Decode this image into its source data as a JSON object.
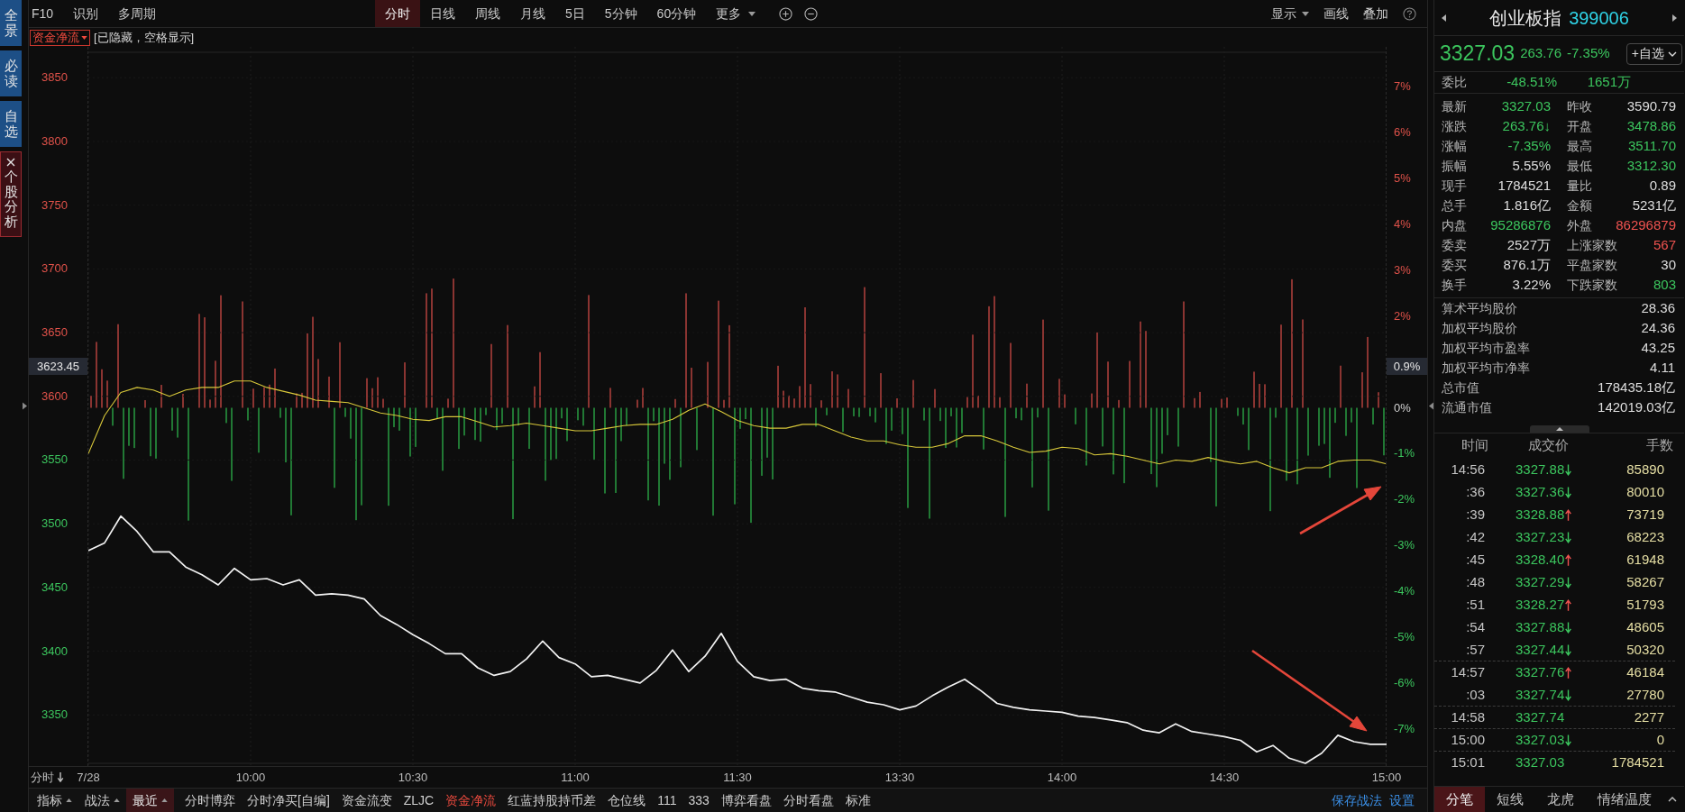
{
  "sidebar": {
    "tabs": [
      {
        "label": "全景",
        "selected": false
      },
      {
        "label": "必读",
        "selected": false
      },
      {
        "label": "自选",
        "selected": false
      },
      {
        "label": "个股分析",
        "selected": true
      }
    ]
  },
  "toolbar": {
    "left": [
      "F10",
      "识别",
      "多周期"
    ],
    "periods": [
      {
        "label": "分时",
        "selected": true
      },
      {
        "label": "日线",
        "selected": false
      },
      {
        "label": "周线",
        "selected": false
      },
      {
        "label": "月线",
        "selected": false
      },
      {
        "label": "5日",
        "selected": false
      },
      {
        "label": "5分钟",
        "selected": false
      },
      {
        "label": "60分钟",
        "selected": false
      }
    ],
    "more": "更多",
    "right": [
      {
        "label": "显示",
        "kind": "menu"
      },
      {
        "label": "画线",
        "kind": "button"
      },
      {
        "label": "叠加",
        "kind": "button"
      }
    ]
  },
  "indicator_bar": {
    "dropdown": "资金净流",
    "note": "[已隐藏，空格显示]"
  },
  "chart": {
    "price_tag": "3623.45",
    "percent_tag": "0.9%",
    "time_button": "分时",
    "chart_data": {
      "type": "line",
      "categories": [
        "7/28",
        null,
        null,
        null,
        null,
        null,
        null,
        null,
        null,
        null,
        "10:00",
        null,
        null,
        null,
        null,
        null,
        null,
        null,
        null,
        null,
        "10:30",
        null,
        null,
        null,
        null,
        null,
        null,
        null,
        null,
        null,
        "11:00",
        null,
        null,
        null,
        null,
        null,
        null,
        null,
        null,
        null,
        "11:30",
        null,
        null,
        null,
        null,
        null,
        null,
        null,
        null,
        null,
        "13:30",
        null,
        null,
        null,
        null,
        null,
        null,
        null,
        null,
        null,
        "14:00",
        null,
        null,
        null,
        null,
        null,
        null,
        null,
        null,
        null,
        "14:30",
        null,
        null,
        null,
        null,
        null,
        null,
        null,
        null,
        null,
        "15:00"
      ],
      "series": [
        {
          "color": "#f2f2f2",
          "values": [
            3479,
            3485,
            3506,
            3494,
            3478,
            3478,
            3466,
            3460,
            3452,
            3465,
            3456,
            3457,
            3452,
            3456,
            3444,
            3445,
            3444,
            3441,
            3428,
            3421,
            3413,
            3406,
            3398,
            3398,
            3387,
            3381,
            3384,
            3394,
            3408,
            3395,
            3390,
            3380,
            3381,
            3378,
            3375,
            3385,
            3401,
            3384,
            3396,
            3414,
            3392,
            3380,
            3377,
            3378,
            3371,
            3369,
            3368,
            3364,
            3360,
            3358,
            3354,
            3357,
            3365,
            3372,
            3378,
            3369,
            3359,
            3356,
            3354,
            3353,
            3352,
            3349,
            3348,
            3346,
            3344,
            3338,
            3336,
            3343,
            3337,
            3335,
            3333,
            3330,
            3321,
            3326,
            3316,
            3312,
            3320,
            3334,
            3329,
            3327,
            3327
          ]
        },
        {
          "color": "#d8c83a",
          "values": [
            3555,
            3585,
            3603,
            3607,
            3605,
            3600,
            3605,
            3607,
            3607,
            3612,
            3612,
            3607,
            3604,
            3601,
            3597,
            3596,
            3595,
            3591,
            3587,
            3585,
            3582,
            3581,
            3584,
            3584,
            3580,
            3576,
            3577,
            3579,
            3577,
            3575,
            3573,
            3573,
            3575,
            3577,
            3578,
            3578,
            3582,
            3589,
            3594,
            3588,
            3581,
            3577,
            3575,
            3575,
            3578,
            3578,
            3573,
            3568,
            3565,
            3565,
            3562,
            3560,
            3560,
            3563,
            3569,
            3569,
            3565,
            3560,
            3556,
            3557,
            3560,
            3559,
            3554,
            3555,
            3553,
            3550,
            3547,
            3550,
            3549,
            3552,
            3549,
            3547,
            3549,
            3544,
            3540,
            3544,
            3544,
            3549,
            3550,
            3550,
            3547
          ]
        }
      ],
      "ylim": [
        3312,
        3870
      ],
      "yticks": [
        3350,
        3400,
        3450,
        3500,
        3550,
        3600,
        3650,
        3700,
        3750,
        3800,
        3850
      ],
      "grid": true,
      "y2lim": [
        -7.75,
        7.75
      ],
      "y2ticks": [
        {
          "value": 7,
          "label": "7%"
        },
        {
          "value": 6,
          "label": "6%"
        },
        {
          "value": 5,
          "label": "5%"
        },
        {
          "value": 4,
          "label": "4%"
        },
        {
          "value": 3,
          "label": "3%"
        },
        {
          "value": 2,
          "label": "2%"
        },
        {
          "value": 0,
          "label": "0%"
        },
        {
          "value": -1,
          "label": "-1%"
        },
        {
          "value": -2,
          "label": "-2%"
        },
        {
          "value": -3,
          "label": "-3%"
        },
        {
          "value": -4,
          "label": "-4%"
        },
        {
          "value": -5,
          "label": "-5%"
        },
        {
          "value": -6,
          "label": "-6%"
        },
        {
          "value": -7,
          "label": "-7%"
        }
      ]
    }
  },
  "bottom_bar": {
    "menus": [
      {
        "label": "指标",
        "selected": false
      },
      {
        "label": "战法",
        "selected": false
      },
      {
        "label": "最近",
        "selected": true
      }
    ],
    "indicators": [
      {
        "label": "分时博弈",
        "selected": false
      },
      {
        "label": "分时净买[自编]",
        "selected": false
      },
      {
        "label": "资金流变",
        "selected": false
      },
      {
        "label": "ZLJC",
        "selected": false
      },
      {
        "label": "资金净流",
        "selected": true
      },
      {
        "label": "红蓝持股持币差",
        "selected": false
      },
      {
        "label": "仓位线",
        "selected": false
      },
      {
        "label": "111",
        "selected": false
      },
      {
        "label": "333",
        "selected": false
      },
      {
        "label": "博弈看盘",
        "selected": false
      },
      {
        "label": "分时看盘",
        "selected": false
      },
      {
        "label": "标准",
        "selected": false
      }
    ],
    "links": [
      "保存战法",
      "设置"
    ]
  },
  "quote_panel": {
    "name": "创业板指",
    "code": "399006",
    "down": true,
    "price": "3327.03",
    "change": "263.76",
    "change_pct": "-7.35%",
    "watch_button": "+自选",
    "commission": {
      "label": "委比",
      "ratio": "-48.51%",
      "diff": "1651万",
      "down": true
    },
    "stats": [
      {
        "label": "最新",
        "value": "3327.03",
        "color": "#3cc65e"
      },
      {
        "label": "昨收",
        "value": "3590.79",
        "color": "#dedede"
      },
      {
        "label": "涨跌",
        "value": "263.76↓",
        "color": "#3cc65e"
      },
      {
        "label": "开盘",
        "value": "3478.86",
        "color": "#3cc65e"
      },
      {
        "label": "涨幅",
        "value": "-7.35%",
        "color": "#3cc65e"
      },
      {
        "label": "最高",
        "value": "3511.70",
        "color": "#3cc65e"
      },
      {
        "label": "振幅",
        "value": "5.55%",
        "color": "#dedede"
      },
      {
        "label": "最低",
        "value": "3312.30",
        "color": "#3cc65e"
      },
      {
        "label": "现手",
        "value": "1784521",
        "color": "#dedede"
      },
      {
        "label": "量比",
        "value": "0.89",
        "color": "#dedede"
      },
      {
        "label": "总手",
        "value": "1.816亿",
        "color": "#dedede"
      },
      {
        "label": "金额",
        "value": "5231亿",
        "color": "#dedede"
      },
      {
        "label": "内盘",
        "value": "95286876",
        "color": "#3cc65e"
      },
      {
        "label": "外盘",
        "value": "86296879",
        "color": "#ef5350"
      },
      {
        "label": "委卖",
        "value": "2527万",
        "color": "#dedede"
      },
      {
        "label": "上涨家数",
        "value": "567",
        "color": "#ef5350"
      },
      {
        "label": "委买",
        "value": "876.1万",
        "color": "#dedede"
      },
      {
        "label": "平盘家数",
        "value": "30",
        "color": "#dedede"
      },
      {
        "label": "换手",
        "value": "3.22%",
        "color": "#dedede"
      },
      {
        "label": "下跌家数",
        "value": "803",
        "color": "#3cc65e"
      }
    ],
    "averages": [
      {
        "label": "算术平均股价",
        "value": "28.36"
      },
      {
        "label": "加权平均股价",
        "value": "24.36"
      },
      {
        "label": "加权平均市盈率",
        "value": "43.25"
      },
      {
        "label": "加权平均市净率",
        "value": "4.11"
      },
      {
        "label": "总市值",
        "value": "178435.18亿"
      },
      {
        "label": "流通市值",
        "value": "142019.03亿"
      }
    ],
    "trades": {
      "columns": [
        "时间",
        "成交价",
        "手数"
      ],
      "rows": [
        {
          "time": "14:56",
          "price": "3327.88",
          "kind": "down",
          "volume": "85890",
          "divider_above": false
        },
        {
          "time": ":36",
          "price": "3327.36",
          "kind": "down",
          "volume": "80010",
          "divider_above": false
        },
        {
          "time": ":39",
          "price": "3328.88",
          "kind": "up",
          "volume": "73719",
          "divider_above": false
        },
        {
          "time": ":42",
          "price": "3327.23",
          "kind": "down",
          "volume": "68223",
          "divider_above": false
        },
        {
          "time": ":45",
          "price": "3328.40",
          "kind": "up",
          "volume": "61948",
          "divider_above": false
        },
        {
          "time": ":48",
          "price": "3327.29",
          "kind": "down",
          "volume": "58267",
          "divider_above": false
        },
        {
          "time": ":51",
          "price": "3328.27",
          "kind": "up",
          "volume": "51793",
          "divider_above": false
        },
        {
          "time": ":54",
          "price": "3327.88",
          "kind": "down",
          "volume": "48605",
          "divider_above": false
        },
        {
          "time": ":57",
          "price": "3327.44",
          "kind": "down",
          "volume": "50320",
          "divider_above": false
        },
        {
          "time": "14:57",
          "price": "3327.76",
          "kind": "up",
          "volume": "46184",
          "divider_above": true
        },
        {
          "time": ":03",
          "price": "3327.74",
          "kind": "down",
          "volume": "27780",
          "divider_above": false
        },
        {
          "time": "14:58",
          "price": "3327.74",
          "kind": "flat",
          "volume": "2277",
          "divider_above": true
        },
        {
          "time": "15:00",
          "price": "3327.03",
          "kind": "down",
          "volume": "0",
          "divider_above": true
        },
        {
          "time": "15:01",
          "price": "3327.03",
          "kind": "flat",
          "volume": "1784521",
          "divider_above": true
        }
      ]
    },
    "tabs": [
      {
        "label": "分笔",
        "selected": true
      },
      {
        "label": "短线",
        "selected": false
      },
      {
        "label": "龙虎",
        "selected": false
      },
      {
        "label": "情绪温度",
        "selected": false
      }
    ]
  }
}
